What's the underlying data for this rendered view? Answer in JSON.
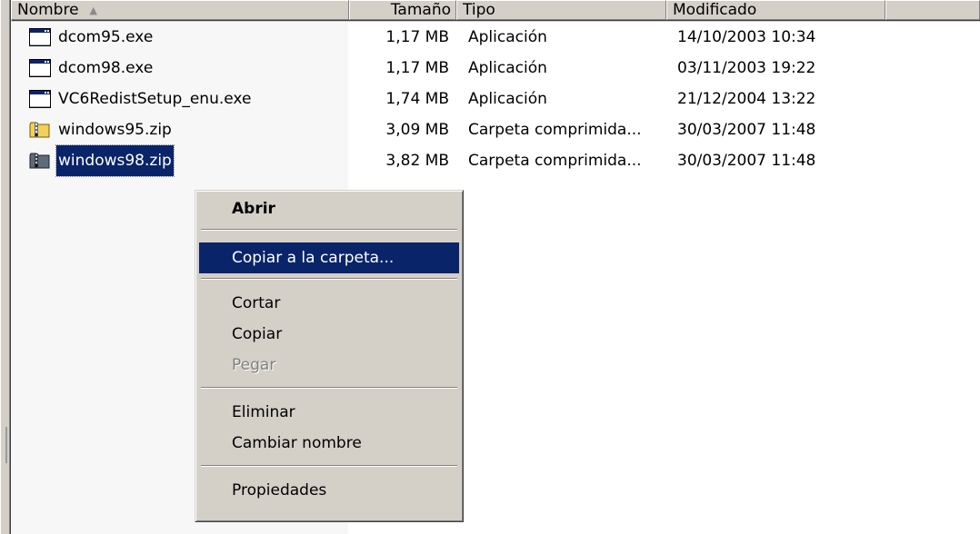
{
  "header": {
    "columns": [
      {
        "label": "Nombre",
        "sort_indicator": "▲"
      },
      {
        "label": "Tamaño"
      },
      {
        "label": "Tipo"
      },
      {
        "label": "Modificado"
      },
      {
        "label": ""
      }
    ]
  },
  "files": [
    {
      "name": "dcom95.exe",
      "size": "1,17 MB",
      "type": "Aplicación",
      "modified": "14/10/2003 10:34",
      "icon": "application-icon"
    },
    {
      "name": "dcom98.exe",
      "size": "1,17 MB",
      "type": "Aplicación",
      "modified": "03/11/2003 19:22",
      "icon": "application-icon"
    },
    {
      "name": "VC6RedistSetup_enu.exe",
      "size": "1,74 MB",
      "type": "Aplicación",
      "modified": "21/12/2004 13:22",
      "icon": "application-icon"
    },
    {
      "name": "windows95.zip",
      "size": "3,09 MB",
      "type": "Carpeta comprimida...",
      "modified": "30/03/2007 11:48",
      "icon": "zip-folder-icon"
    },
    {
      "name": "windows98.zip",
      "size": "3,82 MB",
      "type": "Carpeta comprimida...",
      "modified": "30/03/2007 11:48",
      "icon": "zip-folder-icon",
      "selected": true
    }
  ],
  "context_menu": {
    "open": "Abrir",
    "copy_to_folder": "Copiar a la carpeta...",
    "cut": "Cortar",
    "copy": "Copiar",
    "paste": "Pegar",
    "delete": "Eliminar",
    "rename": "Cambiar nombre",
    "properties": "Propiedades"
  },
  "colors": {
    "selection": "#0a246a",
    "face": "#d4d0c8"
  }
}
